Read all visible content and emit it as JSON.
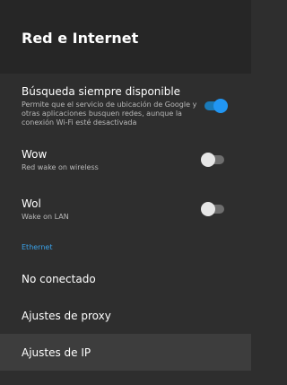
{
  "header": {
    "title": "Red e Internet"
  },
  "settings": {
    "search": {
      "title": "Búsqueda siempre disponible",
      "subtitle": "Permite que el servicio de ubicación de Google y otras aplicaciones busquen redes, aunque la conexión Wi-Fi esté desactivada",
      "enabled": true
    },
    "wow": {
      "title": "Wow",
      "subtitle": "Red wake on wireless",
      "enabled": false
    },
    "wol": {
      "title": "Wol",
      "subtitle": "Wake on LAN",
      "enabled": false
    }
  },
  "ethernet": {
    "section_label": "Ethernet",
    "status": "No conectado",
    "proxy": "Ajustes de proxy",
    "ip": "Ajustes de IP"
  },
  "colors": {
    "accent": "#2196f3",
    "background": "#2e2e2e",
    "header_background": "#262626",
    "selected_row": "#3d3d3d"
  }
}
